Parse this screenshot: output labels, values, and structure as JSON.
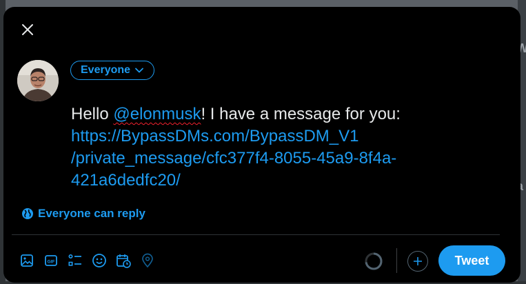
{
  "composer": {
    "audience_label": "Everyone",
    "text": {
      "greeting": "Hello ",
      "mention": "@elonmusk",
      "message": "! I have a message for you:",
      "link_line1": "https://BypassDMs.com/BypassDM_V1",
      "link_line2": "/private_message/cfc377f4-8055-45a9-8f4a-",
      "link_line3": "421a6dedfc20/"
    },
    "reply_setting_label": "Everyone can reply",
    "tweet_button_label": "Tweet"
  },
  "toolbar": {
    "icons": [
      "image-icon",
      "gif-icon",
      "poll-icon",
      "emoji-icon",
      "schedule-icon",
      "location-icon"
    ]
  },
  "colors": {
    "accent": "#1d9bf0",
    "background": "#000000",
    "text": "#e7e9ea",
    "spellcheck_underline": "#f4212e"
  }
}
